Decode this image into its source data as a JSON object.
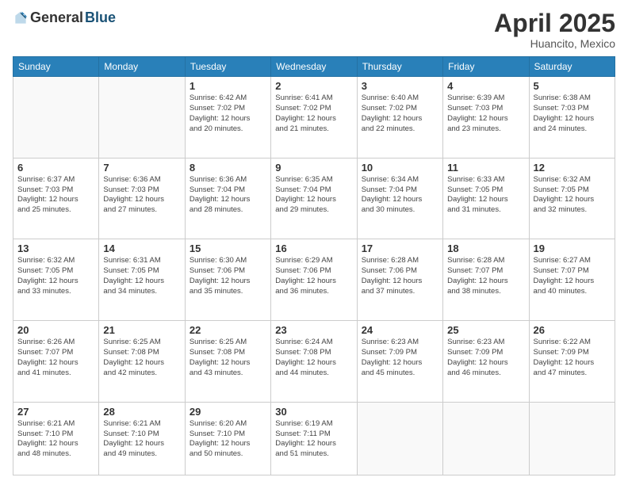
{
  "logo": {
    "general": "General",
    "blue": "Blue"
  },
  "title": "April 2025",
  "subtitle": "Huancito, Mexico",
  "days_header": [
    "Sunday",
    "Monday",
    "Tuesday",
    "Wednesday",
    "Thursday",
    "Friday",
    "Saturday"
  ],
  "weeks": [
    [
      {
        "day": "",
        "info": ""
      },
      {
        "day": "",
        "info": ""
      },
      {
        "day": "1",
        "info": "Sunrise: 6:42 AM\nSunset: 7:02 PM\nDaylight: 12 hours\nand 20 minutes."
      },
      {
        "day": "2",
        "info": "Sunrise: 6:41 AM\nSunset: 7:02 PM\nDaylight: 12 hours\nand 21 minutes."
      },
      {
        "day": "3",
        "info": "Sunrise: 6:40 AM\nSunset: 7:02 PM\nDaylight: 12 hours\nand 22 minutes."
      },
      {
        "day": "4",
        "info": "Sunrise: 6:39 AM\nSunset: 7:03 PM\nDaylight: 12 hours\nand 23 minutes."
      },
      {
        "day": "5",
        "info": "Sunrise: 6:38 AM\nSunset: 7:03 PM\nDaylight: 12 hours\nand 24 minutes."
      }
    ],
    [
      {
        "day": "6",
        "info": "Sunrise: 6:37 AM\nSunset: 7:03 PM\nDaylight: 12 hours\nand 25 minutes."
      },
      {
        "day": "7",
        "info": "Sunrise: 6:36 AM\nSunset: 7:03 PM\nDaylight: 12 hours\nand 27 minutes."
      },
      {
        "day": "8",
        "info": "Sunrise: 6:36 AM\nSunset: 7:04 PM\nDaylight: 12 hours\nand 28 minutes."
      },
      {
        "day": "9",
        "info": "Sunrise: 6:35 AM\nSunset: 7:04 PM\nDaylight: 12 hours\nand 29 minutes."
      },
      {
        "day": "10",
        "info": "Sunrise: 6:34 AM\nSunset: 7:04 PM\nDaylight: 12 hours\nand 30 minutes."
      },
      {
        "day": "11",
        "info": "Sunrise: 6:33 AM\nSunset: 7:05 PM\nDaylight: 12 hours\nand 31 minutes."
      },
      {
        "day": "12",
        "info": "Sunrise: 6:32 AM\nSunset: 7:05 PM\nDaylight: 12 hours\nand 32 minutes."
      }
    ],
    [
      {
        "day": "13",
        "info": "Sunrise: 6:32 AM\nSunset: 7:05 PM\nDaylight: 12 hours\nand 33 minutes."
      },
      {
        "day": "14",
        "info": "Sunrise: 6:31 AM\nSunset: 7:05 PM\nDaylight: 12 hours\nand 34 minutes."
      },
      {
        "day": "15",
        "info": "Sunrise: 6:30 AM\nSunset: 7:06 PM\nDaylight: 12 hours\nand 35 minutes."
      },
      {
        "day": "16",
        "info": "Sunrise: 6:29 AM\nSunset: 7:06 PM\nDaylight: 12 hours\nand 36 minutes."
      },
      {
        "day": "17",
        "info": "Sunrise: 6:28 AM\nSunset: 7:06 PM\nDaylight: 12 hours\nand 37 minutes."
      },
      {
        "day": "18",
        "info": "Sunrise: 6:28 AM\nSunset: 7:07 PM\nDaylight: 12 hours\nand 38 minutes."
      },
      {
        "day": "19",
        "info": "Sunrise: 6:27 AM\nSunset: 7:07 PM\nDaylight: 12 hours\nand 40 minutes."
      }
    ],
    [
      {
        "day": "20",
        "info": "Sunrise: 6:26 AM\nSunset: 7:07 PM\nDaylight: 12 hours\nand 41 minutes."
      },
      {
        "day": "21",
        "info": "Sunrise: 6:25 AM\nSunset: 7:08 PM\nDaylight: 12 hours\nand 42 minutes."
      },
      {
        "day": "22",
        "info": "Sunrise: 6:25 AM\nSunset: 7:08 PM\nDaylight: 12 hours\nand 43 minutes."
      },
      {
        "day": "23",
        "info": "Sunrise: 6:24 AM\nSunset: 7:08 PM\nDaylight: 12 hours\nand 44 minutes."
      },
      {
        "day": "24",
        "info": "Sunrise: 6:23 AM\nSunset: 7:09 PM\nDaylight: 12 hours\nand 45 minutes."
      },
      {
        "day": "25",
        "info": "Sunrise: 6:23 AM\nSunset: 7:09 PM\nDaylight: 12 hours\nand 46 minutes."
      },
      {
        "day": "26",
        "info": "Sunrise: 6:22 AM\nSunset: 7:09 PM\nDaylight: 12 hours\nand 47 minutes."
      }
    ],
    [
      {
        "day": "27",
        "info": "Sunrise: 6:21 AM\nSunset: 7:10 PM\nDaylight: 12 hours\nand 48 minutes."
      },
      {
        "day": "28",
        "info": "Sunrise: 6:21 AM\nSunset: 7:10 PM\nDaylight: 12 hours\nand 49 minutes."
      },
      {
        "day": "29",
        "info": "Sunrise: 6:20 AM\nSunset: 7:10 PM\nDaylight: 12 hours\nand 50 minutes."
      },
      {
        "day": "30",
        "info": "Sunrise: 6:19 AM\nSunset: 7:11 PM\nDaylight: 12 hours\nand 51 minutes."
      },
      {
        "day": "",
        "info": ""
      },
      {
        "day": "",
        "info": ""
      },
      {
        "day": "",
        "info": ""
      }
    ]
  ]
}
